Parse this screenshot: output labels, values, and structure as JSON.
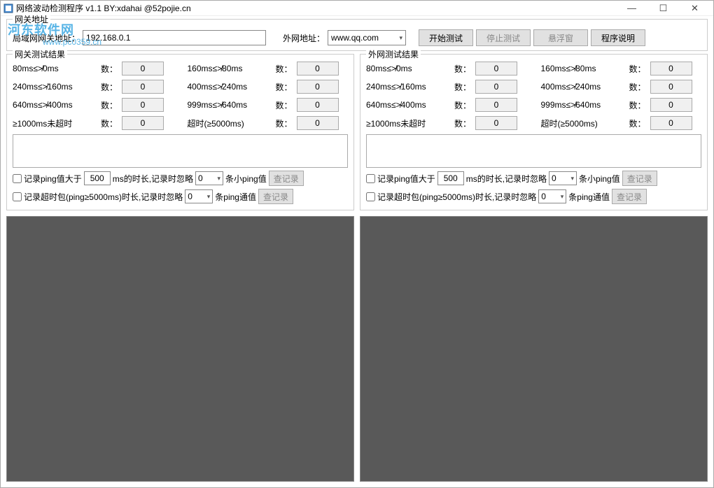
{
  "titlebar": {
    "title": "网络波动检测程序 v1.1 BY:xdahai @52pojie.cn"
  },
  "watermark": {
    "main": "河东软件网",
    "sub": "www.pc0359.cn"
  },
  "gateway_group": {
    "title": "网关地址",
    "lan_label": "局域网网关地址：",
    "lan_value": "192.168.0.1",
    "wan_label": "外网地址：",
    "wan_value": "www.qq.com"
  },
  "buttons": {
    "start": "开始测试",
    "stop": "停止测试",
    "float": "悬浮窗",
    "help": "程序说明",
    "view_log": "查记录"
  },
  "metrics": {
    "r1c1": "80ms≤≯0ms",
    "r1c2": "160ms≤≯80ms",
    "r2c1": "240ms≤≯160ms",
    "r2c2": "400ms≤≯240ms",
    "r3c1": "640ms≤≯400ms",
    "r3c2": "999ms≤≯640ms",
    "r4c1": "≥1000ms未超时",
    "r4c2": "超时(≥5000ms)",
    "count_label": "数：",
    "value": "0"
  },
  "results": {
    "gateway_title": "网关测试结果",
    "wan_title": "外网测试结果"
  },
  "filters": {
    "ping_prefix": "记录ping值大于",
    "ping_value": "500",
    "ping_suffix": "ms的时长,记录时忽略",
    "ignore_value": "0",
    "small_ping": "条小ping值",
    "timeout_prefix": "记录超时包(ping≥5000ms)时长,记录时忽略",
    "ping_comm": "条ping通值"
  }
}
